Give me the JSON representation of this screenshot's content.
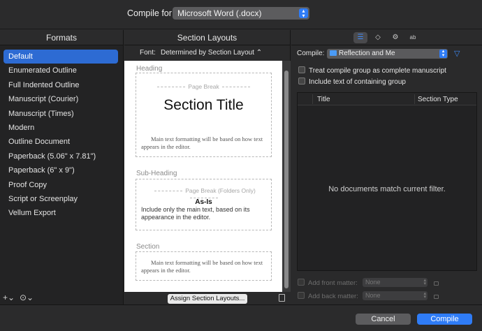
{
  "header": {
    "compile_for_label": "Compile for:",
    "compile_for_value": "Microsoft Word (.docx)"
  },
  "formats": {
    "title": "Formats",
    "items": [
      {
        "label": "Default",
        "selected": true
      },
      {
        "label": "Enumerated Outline"
      },
      {
        "label": "Full Indented Outline"
      },
      {
        "label": "Manuscript (Courier)"
      },
      {
        "label": "Manuscript (Times)"
      },
      {
        "label": "Modern"
      },
      {
        "label": "Outline Document"
      },
      {
        "label": "Paperback (5.06\" x 7.81\")"
      },
      {
        "label": "Paperback (6\" x 9\")"
      },
      {
        "label": "Proof Copy"
      },
      {
        "label": "Script or Screenplay"
      },
      {
        "label": "Vellum Export"
      }
    ],
    "add_glyph": "+⌄",
    "more_glyph": "⊙⌄"
  },
  "layouts": {
    "title": "Section Layouts",
    "font_label": "Font:",
    "font_value": "Determined by Section Layout ⌃",
    "heading": {
      "label": "Heading",
      "page_break": "Page Break",
      "title": "Section Title",
      "body": "Main text formatting will be based on how text appears in the editor."
    },
    "subheading": {
      "label": "Sub-Heading",
      "page_break": "Page Break (Folders Only)",
      "title": "As-Is",
      "body": "Include only the main text, based on its appearance in the editor."
    },
    "section": {
      "label": "Section",
      "body": "Main text formatting will be based on how text appears in the editor."
    },
    "assign_button": "Assign Section Layouts..."
  },
  "right": {
    "toolbar_icons": [
      "list-icon",
      "tag-icon",
      "gear-icon",
      "ab-replace-icon"
    ],
    "ab_icon_text": "ab",
    "compile_label": "Compile:",
    "compile_value": "Reflection and Me",
    "checkbox_treat": "Treat compile group as complete manuscript",
    "checkbox_include": "Include text of containing group",
    "table": {
      "col_title": "Title",
      "col_type": "Section Type",
      "empty_message": "No documents match current filter."
    },
    "front_matter_label": "Add front matter:",
    "back_matter_label": "Add back matter:",
    "front_matter_value": "None",
    "back_matter_value": "None"
  },
  "footer": {
    "cancel": "Cancel",
    "compile": "Compile"
  },
  "colors": {
    "accent": "#2f7cf6",
    "selection": "#2d6bd3"
  }
}
